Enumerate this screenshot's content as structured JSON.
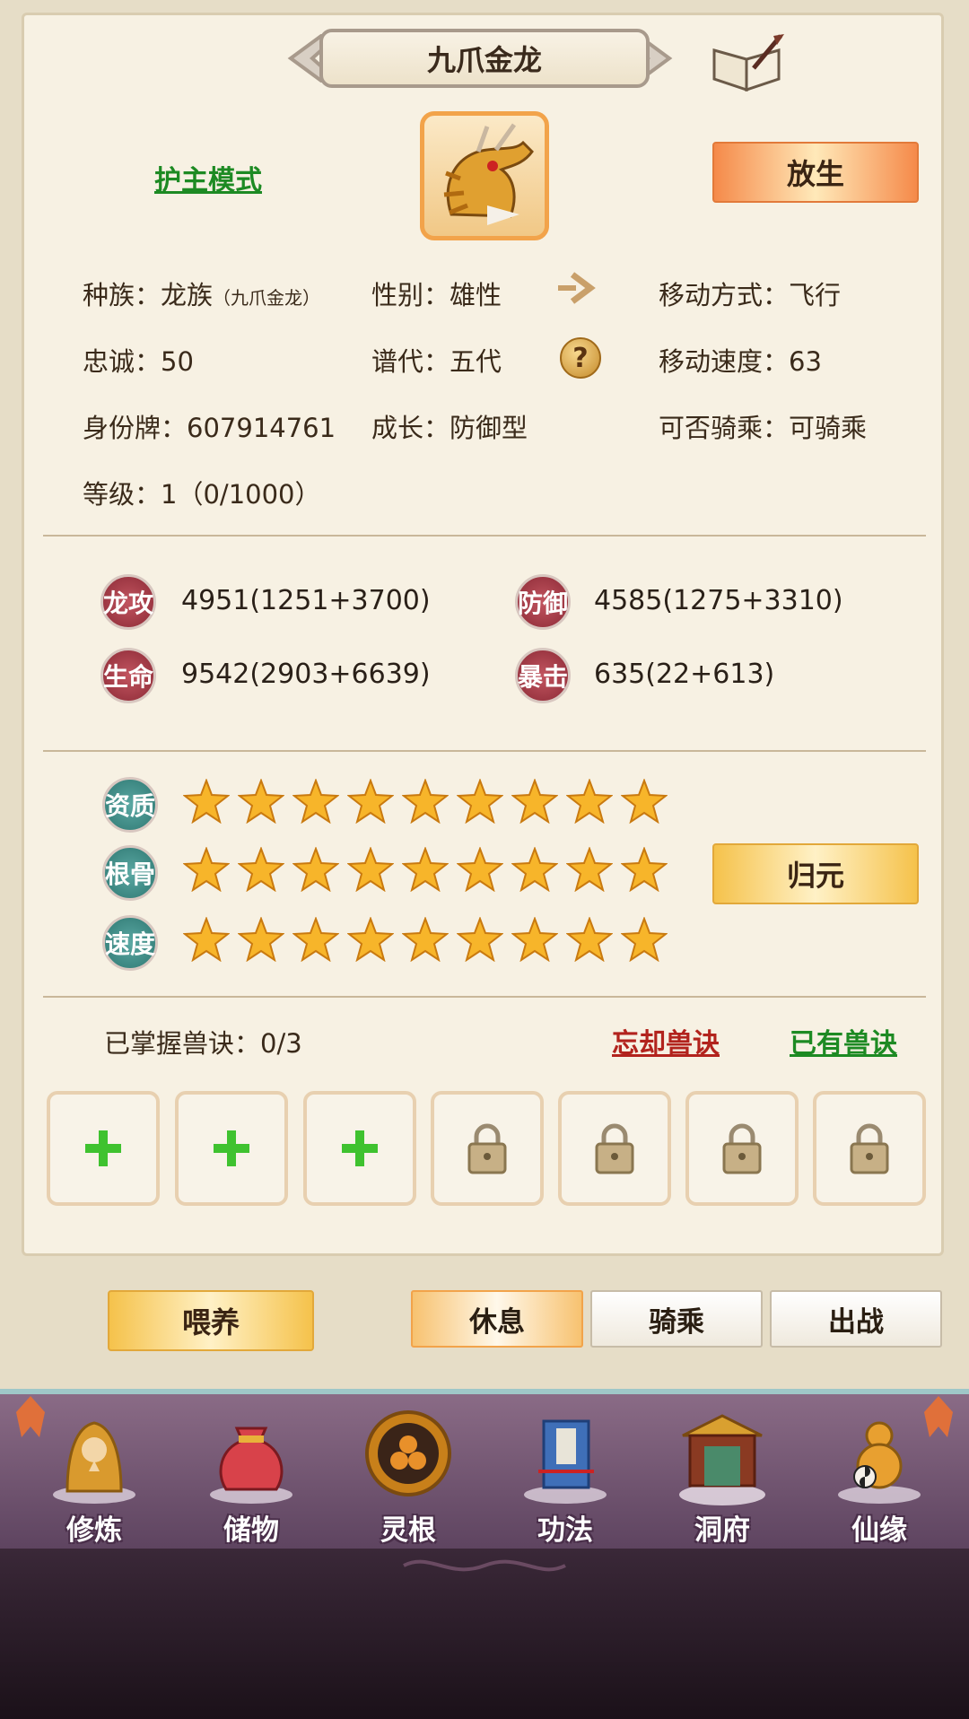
{
  "header": {
    "title": "九爪金龙"
  },
  "mode_link": "护主模式",
  "release_button": "放生",
  "info": {
    "race_label": "种族：",
    "race_value": "龙族",
    "race_sub": "（九爪金龙）",
    "gender_label": "性别：",
    "gender_value": "雄性",
    "move_type_label": "移动方式：",
    "move_type_value": "飞行",
    "loyalty_label": "忠诚：",
    "loyalty_value": "50",
    "generation_label": "谱代：",
    "generation_value": "五代",
    "move_speed_label": "移动速度：",
    "move_speed_value": "63",
    "id_label": "身份牌：",
    "id_value": "607914761",
    "growth_label": "成长：",
    "growth_value": "防御型",
    "rideable_label": "可否骑乘：",
    "rideable_value": "可骑乘",
    "level_label": "等级：",
    "level_value": "1（0/1000）"
  },
  "stats": [
    {
      "label": "龙攻",
      "value": "4951(1251+3700)"
    },
    {
      "label": "防御",
      "value": "4585(1275+3310)"
    },
    {
      "label": "生命",
      "value": "9542(2903+6639)"
    },
    {
      "label": "暴击",
      "value": "635(22+613)"
    }
  ],
  "aptitudes": [
    {
      "label": "资质",
      "stars": 9
    },
    {
      "label": "根骨",
      "stars": 9
    },
    {
      "label": "速度",
      "stars": 9
    }
  ],
  "reset_button": "归元",
  "skills": {
    "mastered_label": "已掌握兽诀：0/3",
    "forget_link": "忘却兽诀",
    "owned_link": "已有兽诀"
  },
  "actions": {
    "feed": "喂养",
    "rest": "休息",
    "ride": "骑乘",
    "battle": "出战"
  },
  "nav": [
    {
      "label": "修炼",
      "icon": "monk-icon"
    },
    {
      "label": "储物",
      "icon": "bag-icon"
    },
    {
      "label": "灵根",
      "icon": "spirit-root-icon"
    },
    {
      "label": "功法",
      "icon": "book-icon"
    },
    {
      "label": "洞府",
      "icon": "palace-icon"
    },
    {
      "label": "仙缘",
      "icon": "gourd-icon"
    }
  ],
  "colors": {
    "link_green": "#1d8a23",
    "link_red": "#b2231d",
    "accent_orange": "#f58a4a",
    "accent_gold": "#f5c24b"
  }
}
